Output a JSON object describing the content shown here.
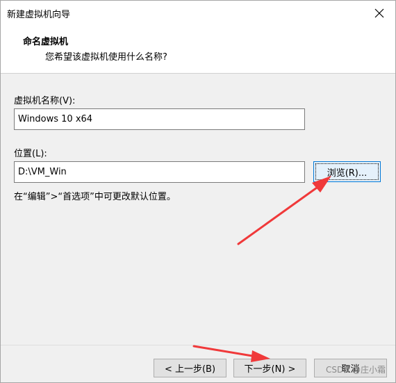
{
  "window": {
    "title": "新建虚拟机向导"
  },
  "header": {
    "title": "命名虚拟机",
    "subtitle": "您希望该虚拟机使用什么名称?"
  },
  "form": {
    "name_label": "虚拟机名称(V):",
    "name_value": "Windows 10 x64",
    "location_label": "位置(L):",
    "location_value": "D:\\VM_Win",
    "browse_label": "浏览(R)...",
    "hint": "在“编辑”>“首选项”中可更改默认位置。"
  },
  "footer": {
    "back_label": "< 上一步(B)",
    "next_label": "下一步(N) >",
    "cancel_label": "取消"
  },
  "watermark": "CSDN @庄小霜",
  "colors": {
    "accent": "#0078d7",
    "annotation_arrow": "#f0393a"
  },
  "icons": {
    "close": "close-icon"
  }
}
